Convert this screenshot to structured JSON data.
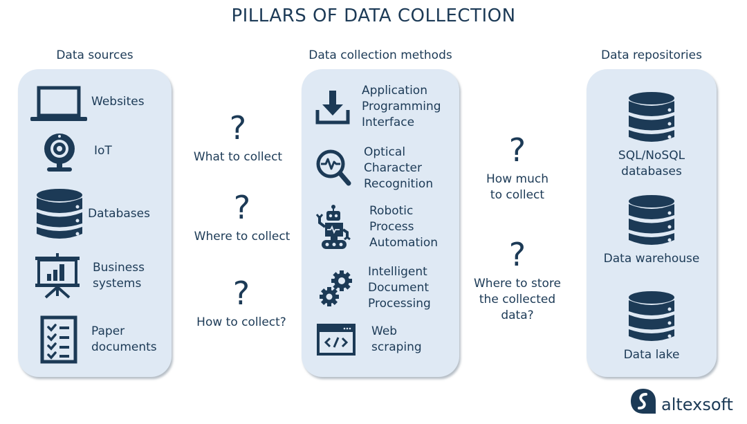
{
  "title": "PILLARS OF DATA COLLECTION",
  "colors": {
    "text": "#1c3a56",
    "panel": "#dfe9f4",
    "background": "#ffffff"
  },
  "sources": {
    "heading": "Data sources",
    "items": [
      {
        "label": "Websites",
        "icon": "laptop-icon"
      },
      {
        "label": "IoT",
        "icon": "webcam-icon"
      },
      {
        "label": "Databases",
        "icon": "database-icon"
      },
      {
        "label": "Business\nsystems",
        "icon": "presentation-chart-icon"
      },
      {
        "label": "Paper\ndocuments",
        "icon": "checklist-icon"
      }
    ]
  },
  "questions_left": [
    {
      "mark": "?",
      "text": "What to collect"
    },
    {
      "mark": "?",
      "text": "Where to collect"
    },
    {
      "mark": "?",
      "text": "How to collect?"
    }
  ],
  "methods": {
    "heading": "Data collection methods",
    "items": [
      {
        "label": "Application\nProgramming\nInterface",
        "icon": "download-icon"
      },
      {
        "label": "Optical\nCharacter\nRecognition",
        "icon": "magnifier-pulse-icon"
      },
      {
        "label": "Robotic\nProcess\nAutomation",
        "icon": "robot-icon"
      },
      {
        "label": "Intelligent\nDocument\nProcessing",
        "icon": "gears-icon"
      },
      {
        "label": "Web\nscraping",
        "icon": "code-window-icon"
      }
    ]
  },
  "questions_right": [
    {
      "mark": "?",
      "text": "How much\nto collect"
    },
    {
      "mark": "?",
      "text": "Where to store\nthe collected\ndata?"
    }
  ],
  "repositories": {
    "heading": "Data repositories",
    "items": [
      {
        "label": "SQL/NoSQL\ndatabases",
        "icon": "database-icon"
      },
      {
        "label": "Data warehouse",
        "icon": "database-icon"
      },
      {
        "label": "Data lake",
        "icon": "database-icon"
      }
    ]
  },
  "logo": {
    "text": "altexsoft"
  }
}
